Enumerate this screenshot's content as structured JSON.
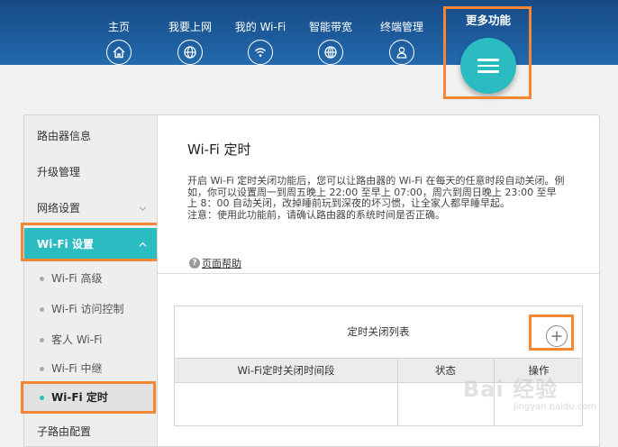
{
  "nav": {
    "items": [
      {
        "label": "主页",
        "icon": "home-icon"
      },
      {
        "label": "我要上网",
        "icon": "globe-icon"
      },
      {
        "label": "我的 Wi-Fi",
        "icon": "wifi-icon"
      },
      {
        "label": "智能带宽",
        "icon": "bandwidth-icon"
      },
      {
        "label": "终端管理",
        "icon": "user-icon"
      }
    ],
    "more_label": "更多功能",
    "more_icon": "menu-icon"
  },
  "sidebar": {
    "router_info": "路由器信息",
    "upgrade": "升级管理",
    "network": "网络设置",
    "wifi_settings": "Wi-Fi 设置",
    "sub": {
      "advanced": "Wi-Fi 高级",
      "access_control": "Wi-Fi 访问控制",
      "guest": "客人 Wi-Fi",
      "relay": "Wi-Fi 中继",
      "timer": "Wi-Fi 定时"
    },
    "sub_router": "子路由配置"
  },
  "main": {
    "title": "Wi-Fi 定时",
    "description_1": "开启 Wi-Fi 定时关闭功能后，您可以让路由器的 Wi-Fi 在每天的任意时段自动关闭。例如，你可以设置周一到周五晚上 22:00 至早上 07:00，周六到周日晚上 23:00 至早上 8：00 自动关闭，改掉睡前玩到深夜的坏习惯，让全家人都早睡早起。",
    "description_2": "注意：使用此功能前，请确认路由器的系统时间是否正确。",
    "help_icon": "question-icon",
    "help_label": "页面帮助",
    "table": {
      "title": "定时关闭列表",
      "add_icon": "plus-icon",
      "columns": [
        "Wi-Fi定时关闭时间段",
        "状态",
        "操作"
      ]
    }
  },
  "watermark": {
    "text": "Bai 经验",
    "sub": "jingyan.baidu.com"
  },
  "colors": {
    "nav_blue": "#1d5b9c",
    "accent_teal": "#2bbcc2",
    "highlight_orange": "#f58634"
  }
}
